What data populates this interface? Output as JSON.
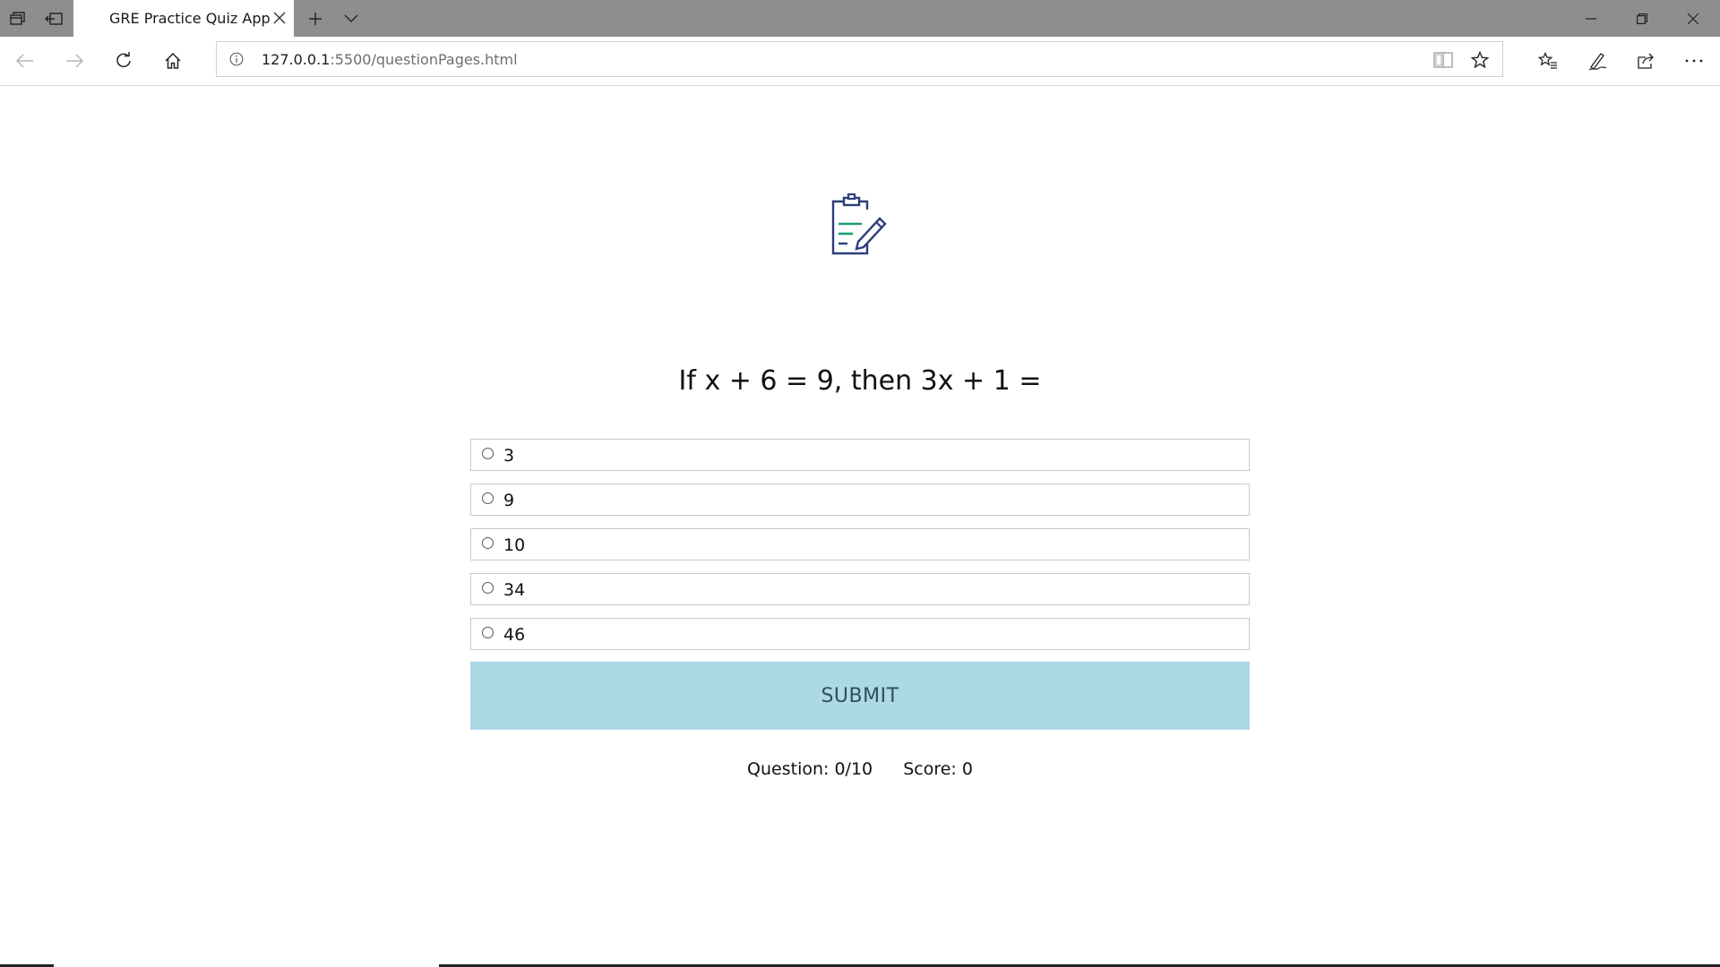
{
  "browser": {
    "tab_title": "GRE Practice Quiz App",
    "url_host": "127.0.0.1",
    "url_path": ":5500/questionPages.html"
  },
  "icons": {
    "tab_actions": "tab-actions-icon",
    "set_aside": "set-aside-tabs-icon",
    "new_tab": "plus-icon",
    "tab_menu": "chevron-down-icon",
    "minimize": "minimize-icon",
    "restore": "restore-icon",
    "close": "close-icon",
    "back": "back-arrow-icon",
    "forward": "forward-arrow-icon",
    "refresh": "refresh-icon",
    "home": "home-icon",
    "site_info": "info-icon",
    "reading_view": "reading-view-icon",
    "favorite": "star-icon",
    "favorites": "favorites-list-icon",
    "notes": "pen-icon",
    "share": "share-icon",
    "more": "more-icon",
    "logo": "clipboard-pencil-icon"
  },
  "colors": {
    "titlebar": "#8e8e8e",
    "submit_bg": "#add8e6",
    "logo_blue": "#2c3e7a",
    "logo_green": "#1a9e6e"
  },
  "quiz": {
    "question": "If x + 6 = 9, then 3x + 1 =",
    "options": [
      "3",
      "9",
      "10",
      "34",
      "46"
    ],
    "submit_label": "SUBMIT",
    "question_counter": "Question: 0/10",
    "score": "Score: 0"
  }
}
